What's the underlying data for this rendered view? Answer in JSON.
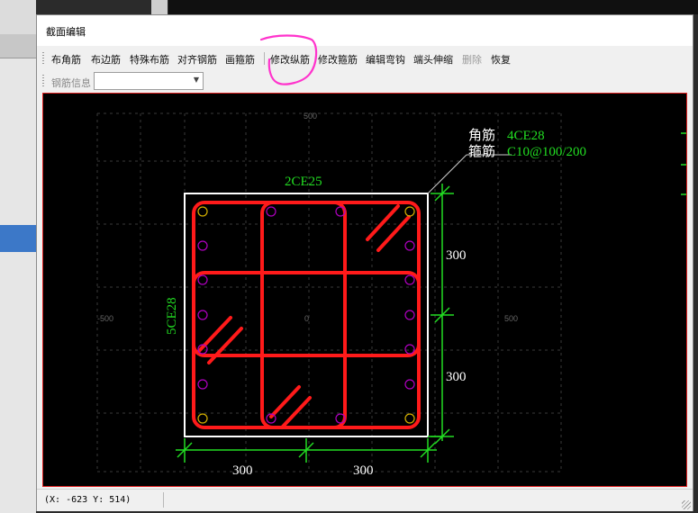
{
  "window": {
    "title": "截面编辑"
  },
  "toolbar": {
    "buttons": [
      {
        "label": "布角筋"
      },
      {
        "label": "布边筋"
      },
      {
        "label": "特殊布筋"
      },
      {
        "label": "对齐钢筋"
      },
      {
        "label": "画箍筋"
      },
      {
        "label": "修改纵筋"
      },
      {
        "label": "修改箍筋"
      },
      {
        "label": "编辑弯钩"
      },
      {
        "label": "端头伸缩"
      },
      {
        "label": "删除",
        "disabled": true
      },
      {
        "label": "恢复"
      }
    ]
  },
  "rebar_info": {
    "label": "钢筋信息",
    "value": ""
  },
  "drawing": {
    "top_rebar": "2CE25",
    "side_rebar": "5CE28",
    "corner_label": "角筋",
    "corner_value": "4CE28",
    "stirrup_label": "箍筋",
    "stirrup_value": "C10@100/200",
    "dim_right_top": "300",
    "dim_right_bottom": "300",
    "dim_bottom_left": "300",
    "dim_bottom_right": "300",
    "axis_top": "500",
    "axis_left": "-500",
    "axis_right": "500",
    "axis_center": "0"
  },
  "status": {
    "coords": "(X: -623 Y: 514)"
  },
  "colors": {
    "canvas": "#000000",
    "rebar": "#ff1a1a",
    "dimension": "#22dd22",
    "annotation_green": "#22dd22",
    "annotation_white": "#ffffff",
    "point": "#b000c0",
    "corner_point": "#d4b000",
    "highlight": "#ff33cc"
  }
}
